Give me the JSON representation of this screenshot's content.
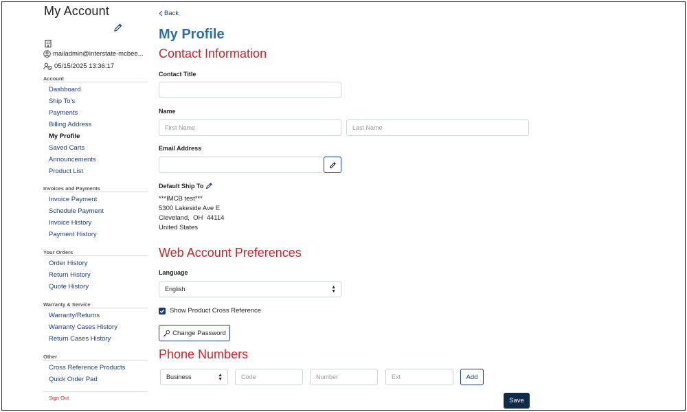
{
  "sidebar": {
    "title": "My Account",
    "email": "mailadmin@interstate-mcbee...",
    "last_login": "05/15/2025 13:36:17",
    "groups": [
      {
        "heading": "Account",
        "items": [
          {
            "label": "Dashboard",
            "active": false
          },
          {
            "label": "Ship To's",
            "active": false
          },
          {
            "label": "Payments",
            "active": false
          },
          {
            "label": "Billing Address",
            "active": false
          },
          {
            "label": "My Profile",
            "active": true
          },
          {
            "label": "Saved Carts",
            "active": false
          },
          {
            "label": "Announcements",
            "active": false
          },
          {
            "label": "Product List",
            "active": false
          }
        ]
      },
      {
        "heading": "Invoices and Payments",
        "items": [
          {
            "label": "Invoice Payment",
            "active": false
          },
          {
            "label": "Schedule Payment",
            "active": false
          },
          {
            "label": "Invoice History",
            "active": false
          },
          {
            "label": "Payment History",
            "active": false
          }
        ]
      },
      {
        "heading": "Your Orders",
        "items": [
          {
            "label": "Order History",
            "active": false
          },
          {
            "label": "Return History",
            "active": false
          },
          {
            "label": "Quote History",
            "active": false
          }
        ]
      },
      {
        "heading": "Warranty & Service",
        "items": [
          {
            "label": "Warranty/Returns",
            "active": false
          },
          {
            "label": "Warranty Cases History",
            "active": false
          },
          {
            "label": "Return Cases History",
            "active": false
          }
        ]
      },
      {
        "heading": "Other",
        "items": [
          {
            "label": "Cross Reference Products",
            "active": false
          },
          {
            "label": "Quick Order Pad",
            "active": false
          }
        ]
      }
    ],
    "sign_out": "Sign Out"
  },
  "main": {
    "back_label": "Back",
    "page_title": "My Profile",
    "contact": {
      "heading": "Contact Information",
      "contact_title_label": "Contact Title",
      "contact_title_value": "",
      "name_label": "Name",
      "first_name_placeholder": "First Name",
      "last_name_placeholder": "Last Name",
      "email_label": "Email Address",
      "email_value": "",
      "default_ship_to_label": "Default Ship To",
      "address": {
        "line1": "***IMCB test***",
        "line2": "5300 Lakeside Ave E",
        "city_line": "Cleveland,  OH  44114",
        "country": "United States"
      }
    },
    "preferences": {
      "heading": "Web Account Preferences",
      "language_label": "Language",
      "language_value": "English",
      "cross_ref_label": "Show Product Cross Reference",
      "cross_ref_checked": true,
      "change_password_label": "Change Password"
    },
    "phone": {
      "heading": "Phone Numbers",
      "type_value": "Business",
      "code_placeholder": "Code",
      "number_placeholder": "Number",
      "ext_placeholder": "Ext",
      "add_label": "Add"
    },
    "save_label": "Save"
  },
  "colors": {
    "title_blue": "#2f6fa3",
    "section_red": "#c0282d",
    "nav_blue": "#1d3d74",
    "save_bg": "#0f2a4a",
    "sign_out_red": "#c62828"
  },
  "icons": {
    "edit": "pencil-icon",
    "company": "building-icon",
    "user": "user-circle-icon",
    "login": "user-clock-icon",
    "back": "chevron-left-icon",
    "key": "key-icon",
    "check": "check-icon"
  }
}
